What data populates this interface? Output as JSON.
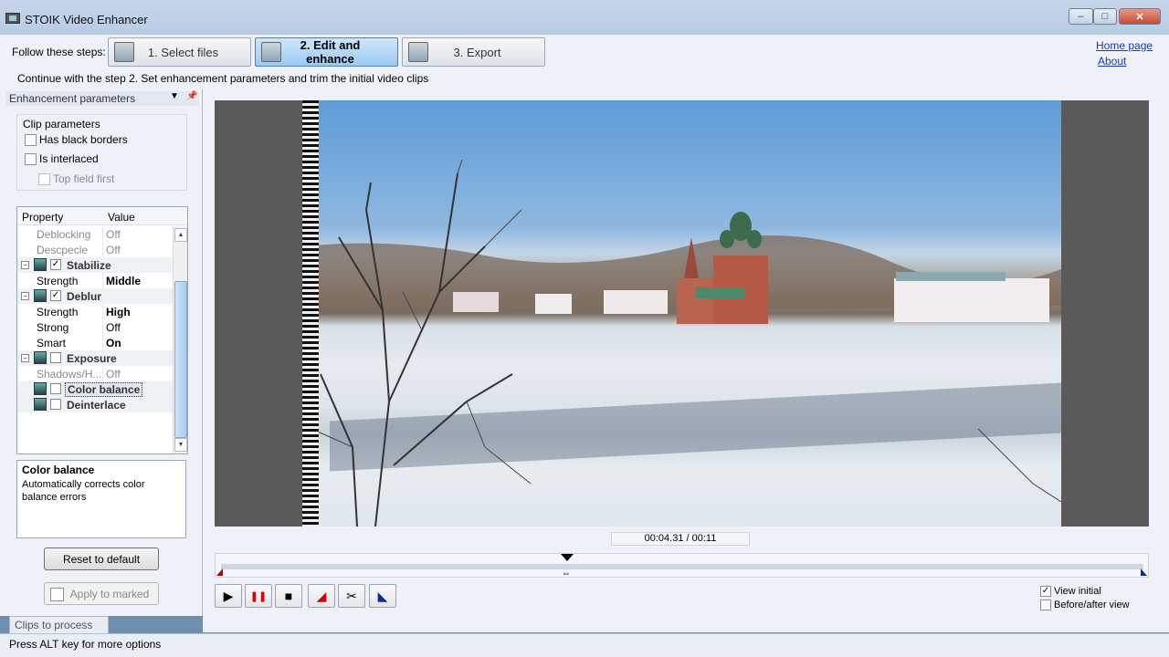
{
  "window": {
    "title": "STOIK Video Enhancer",
    "minimize": "–",
    "maximize": "□",
    "close": "✕"
  },
  "steps": {
    "label": "Follow these steps:",
    "items": [
      {
        "label": "1. Select files",
        "icon": "select-files-icon"
      },
      {
        "label": "2. Edit and enhance",
        "icon": "edit-enhance-icon"
      },
      {
        "label": "3. Export",
        "icon": "export-icon"
      }
    ],
    "active_index": 1,
    "hint": "Continue with the step 2. Set enhancement parameters and trim the initial video clips"
  },
  "links": {
    "home": "Home page",
    "about": "About"
  },
  "left_panel": {
    "title": "Enhancement parameters",
    "clip_parameters": {
      "label": "Clip parameters",
      "has_black_borders": {
        "label": "Has black borders",
        "checked": false
      },
      "is_interlaced": {
        "label": "Is interlaced",
        "checked": false
      },
      "top_field_first": {
        "label": "Top field first",
        "checked": false,
        "disabled": true
      }
    },
    "property_table": {
      "col_property": "Property",
      "col_value": "Value",
      "rows": [
        {
          "name": "Deblocking",
          "value": "Off"
        },
        {
          "name": "Descpecle",
          "value": "Off"
        },
        {
          "name": "Stabilize",
          "value": ""
        },
        {
          "name": "Strength",
          "value": "Middle"
        },
        {
          "name": "Deblur",
          "value": ""
        },
        {
          "name": "Strength",
          "value": "High"
        },
        {
          "name": "Strong",
          "value": "Off"
        },
        {
          "name": "Smart",
          "value": "On"
        },
        {
          "name": "Exposure",
          "value": ""
        },
        {
          "name": "Shadows/H...",
          "value": "Off"
        },
        {
          "name": "Color balance",
          "value": ""
        },
        {
          "name": "Deinterlace",
          "value": ""
        }
      ]
    },
    "description": {
      "title": "Color balance",
      "text": "Automatically corrects color balance errors"
    },
    "reset_button": "Reset to default",
    "apply_button": "Apply to marked",
    "bottom_tab": "Clips to process"
  },
  "player": {
    "timecode": "00:04.31 / 00:11",
    "position_fraction": 0.375,
    "controls": {
      "play": "▶",
      "pause": "❚❚",
      "stop": "■",
      "mark_in": "◢",
      "cut": "✂",
      "mark_out": "◣"
    },
    "view_initial": {
      "label": "View initial",
      "checked": true
    },
    "before_after": {
      "label": "Before/after view",
      "checked": false
    }
  },
  "status_bar": {
    "text": "Press ALT key for more options"
  }
}
